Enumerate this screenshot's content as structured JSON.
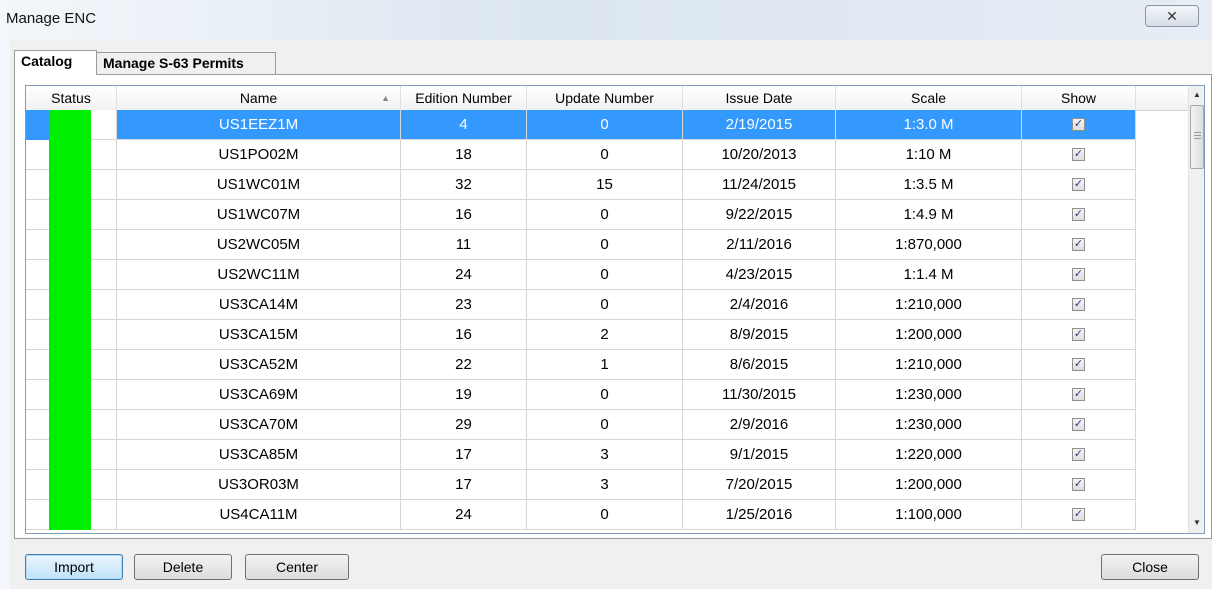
{
  "window": {
    "title": "Manage ENC",
    "close_icon": "✕"
  },
  "tabs": [
    {
      "label": "Catalog",
      "active": true
    },
    {
      "label": "Manage S-63 Permits",
      "active": false
    }
  ],
  "table": {
    "columns": [
      "Status",
      "Name",
      "Edition Number",
      "Update Number",
      "Issue Date",
      "Scale",
      "Show"
    ],
    "sort_column": "Name",
    "sort_direction": "ascending",
    "status_color": "#00ee00",
    "selection_color": "#3399ff",
    "rows": [
      {
        "name": "US1EEZ1M",
        "edition": "4",
        "update": "0",
        "issue_date": "2/19/2015",
        "scale": "1:3.0 M",
        "show": true
      },
      {
        "name": "US1PO02M",
        "edition": "18",
        "update": "0",
        "issue_date": "10/20/2013",
        "scale": "1:10 M",
        "show": true
      },
      {
        "name": "US1WC01M",
        "edition": "32",
        "update": "15",
        "issue_date": "11/24/2015",
        "scale": "1:3.5 M",
        "show": true
      },
      {
        "name": "US1WC07M",
        "edition": "16",
        "update": "0",
        "issue_date": "9/22/2015",
        "scale": "1:4.9 M",
        "show": true
      },
      {
        "name": "US2WC05M",
        "edition": "11",
        "update": "0",
        "issue_date": "2/11/2016",
        "scale": "1:870,000",
        "show": true
      },
      {
        "name": "US2WC11M",
        "edition": "24",
        "update": "0",
        "issue_date": "4/23/2015",
        "scale": "1:1.4 M",
        "show": true
      },
      {
        "name": "US3CA14M",
        "edition": "23",
        "update": "0",
        "issue_date": "2/4/2016",
        "scale": "1:210,000",
        "show": true
      },
      {
        "name": "US3CA15M",
        "edition": "16",
        "update": "2",
        "issue_date": "8/9/2015",
        "scale": "1:200,000",
        "show": true
      },
      {
        "name": "US3CA52M",
        "edition": "22",
        "update": "1",
        "issue_date": "8/6/2015",
        "scale": "1:210,000",
        "show": true
      },
      {
        "name": "US3CA69M",
        "edition": "19",
        "update": "0",
        "issue_date": "11/30/2015",
        "scale": "1:230,000",
        "show": true
      },
      {
        "name": "US3CA70M",
        "edition": "29",
        "update": "0",
        "issue_date": "2/9/2016",
        "scale": "1:230,000",
        "show": true
      },
      {
        "name": "US3CA85M",
        "edition": "17",
        "update": "3",
        "issue_date": "9/1/2015",
        "scale": "1:220,000",
        "show": true
      },
      {
        "name": "US3OR03M",
        "edition": "17",
        "update": "3",
        "issue_date": "7/20/2015",
        "scale": "1:200,000",
        "show": true
      },
      {
        "name": "US4CA11M",
        "edition": "24",
        "update": "0",
        "issue_date": "1/25/2016",
        "scale": "1:100,000",
        "show": true
      }
    ],
    "selected_row": 0
  },
  "buttons": {
    "import": "Import",
    "delete": "Delete",
    "center": "Center",
    "close": "Close"
  }
}
